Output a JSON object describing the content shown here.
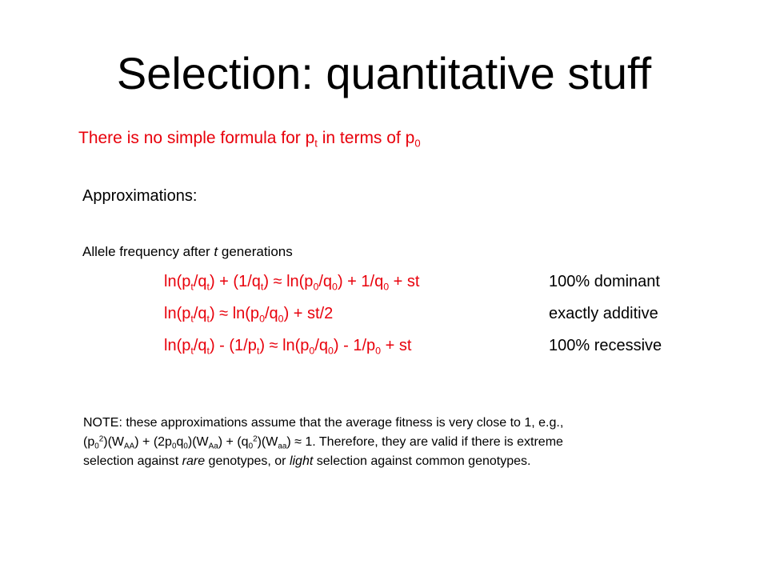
{
  "slide": {
    "title": "Selection:  quantitative stuff",
    "intro": {
      "text_a": "There is no simple formula for p",
      "sub_a": "t",
      "text_b": " in terms of p",
      "sub_b": "0"
    },
    "approximations_label": "Approximations:",
    "allele_heading": {
      "text_a": "Allele frequency after ",
      "t_italic": "t",
      "text_b": " generations"
    },
    "equations": [
      {
        "parts": [
          "ln(p",
          "t",
          "/q",
          "t",
          ") + (1/q",
          "t",
          ") ≈ ln(p",
          "0",
          "/q",
          "0",
          ") + 1/q",
          "0",
          " + st"
        ],
        "label": "100% dominant"
      },
      {
        "parts": [
          "ln(p",
          "t",
          "/q",
          "t",
          ") ≈ ln(p",
          "0",
          "/q",
          "0",
          ") + st/2"
        ],
        "label": "exactly additive"
      },
      {
        "parts": [
          "ln(p",
          "t",
          "/q",
          "t",
          ") - (1/p",
          "t",
          ") ≈ ln(p",
          "0",
          "/q",
          "0",
          ") - 1/p",
          "0",
          " + st"
        ],
        "label": "100% recessive"
      }
    ],
    "note": {
      "line1": "NOTE:  these approximations assume that the average fitness is very close to 1, e.g.,",
      "l2": [
        "(p",
        "0",
        "2",
        ")(W",
        "AA",
        ") + (2p",
        "0",
        "q",
        "0",
        ")(W",
        "Aa",
        ") + (q",
        "0",
        "2",
        ")(W",
        "aa",
        ") ≈ 1.  Therefore, they are valid if there is extreme"
      ],
      "line3_a": "selection against ",
      "line3_rare": "rare",
      "line3_b": " genotypes, or ",
      "line3_light": "light",
      "line3_c": " selection against common genotypes."
    },
    "colors": {
      "accent_red": "#e8000b",
      "text": "#000000",
      "background": "#ffffff"
    }
  }
}
